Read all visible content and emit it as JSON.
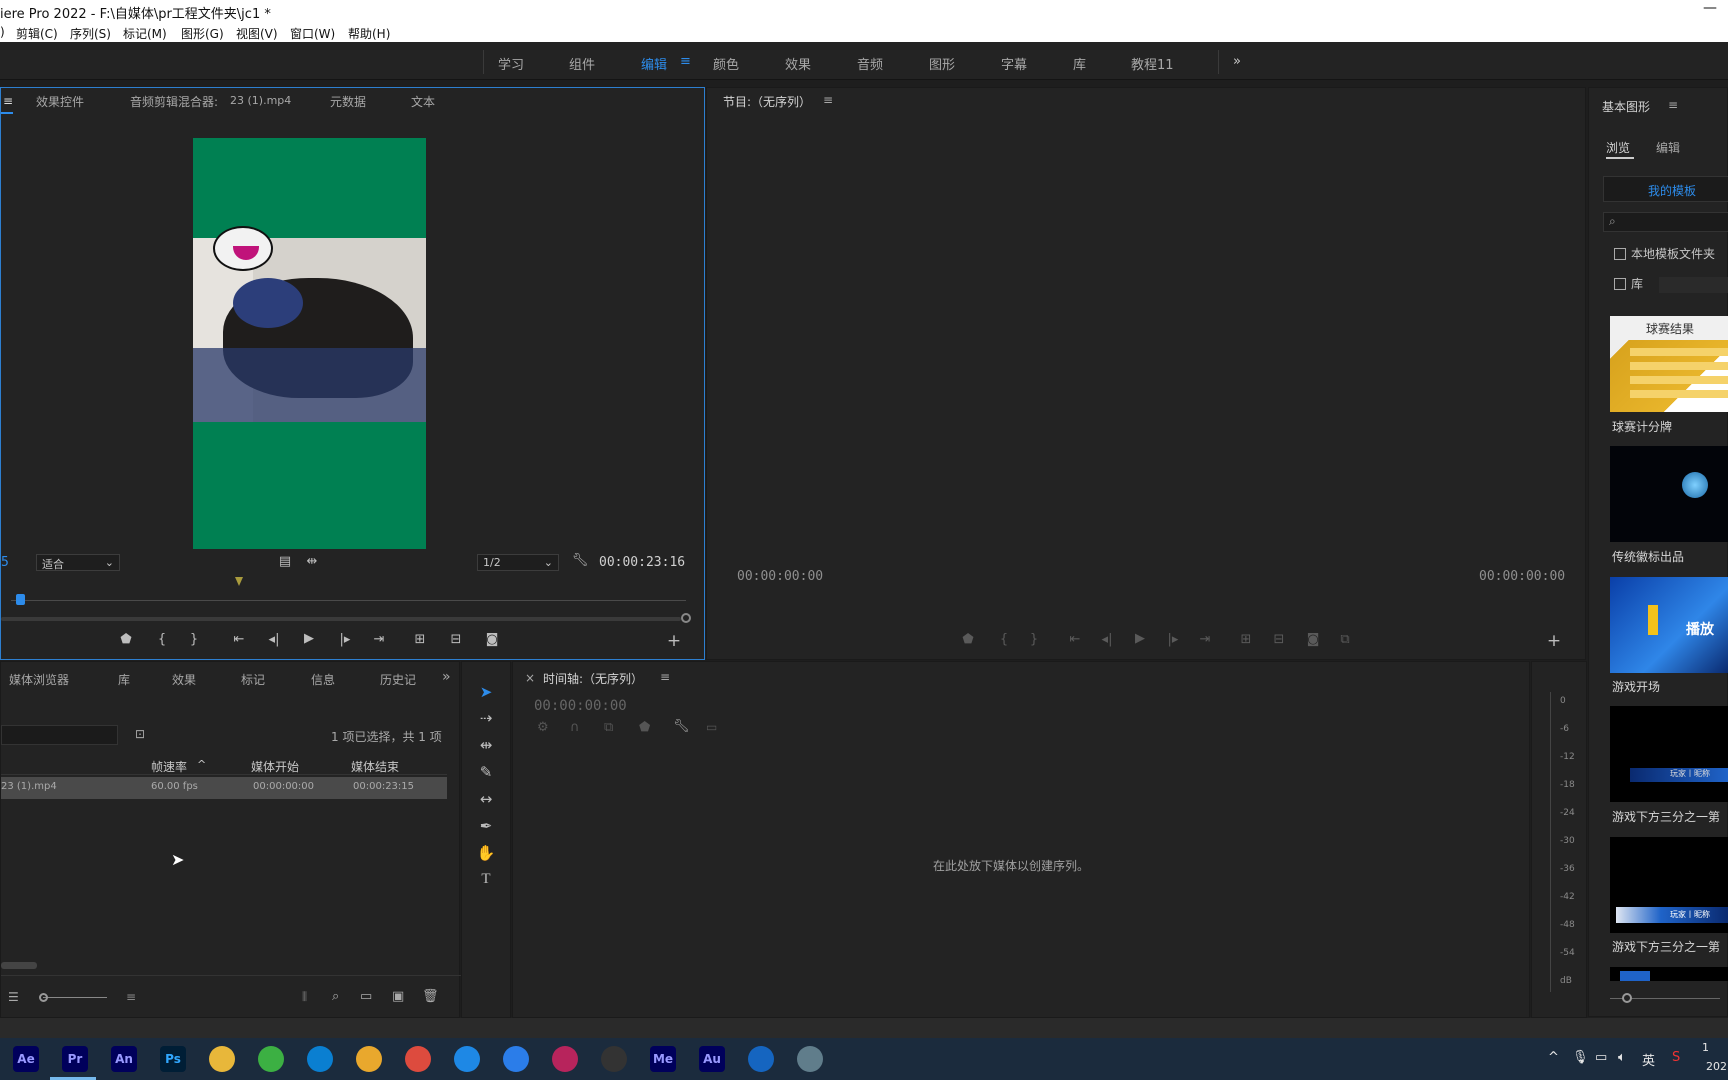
{
  "window": {
    "title": "iere Pro 2022 - F:\\自媒体\\pr工程文件夹\\jc1 *",
    "minimize_glyph": "—"
  },
  "menu": {
    "partial": ")",
    "items": [
      "剪辑(C)",
      "序列(S)",
      "标记(M)",
      "图形(G)",
      "视图(V)",
      "窗口(W)",
      "帮助(H)"
    ]
  },
  "workspaces": {
    "items": [
      "学习",
      "组件",
      "编辑",
      "颜色",
      "效果",
      "音频",
      "图形",
      "字幕",
      "库",
      "教程11"
    ],
    "active": "编辑",
    "menu_glyph": "≡",
    "overflow": "»"
  },
  "source_panel": {
    "tabs": [
      "效果控件",
      "音频剪辑混合器:",
      "元数据",
      "文本"
    ],
    "mixer_clip": "23 (1).mp4",
    "menu_glyph": "≡",
    "playhead_partial": "5",
    "fit_select": "适合",
    "resolution_select": "1/2",
    "timecode": "00:00:23:16",
    "video_bg": "#008052"
  },
  "program_panel": {
    "title": "节目:（无序列）",
    "menu_glyph": "≡",
    "tc_left": "00:00:00:00",
    "tc_right": "00:00:00:00"
  },
  "project_panel": {
    "tabs": [
      "媒体浏览器",
      "库",
      "效果",
      "标记",
      "信息",
      "历史记"
    ],
    "overflow": "»",
    "selection_info": "1 项已选择，共 1 项",
    "columns": [
      "帧速率",
      "媒体开始",
      "媒体结束"
    ],
    "sort_glyph": "^",
    "rows": [
      {
        "name": "23 (1).mp4",
        "fps": "60.00 fps",
        "start": "00:00:00:00",
        "end": "00:00:23:15"
      }
    ]
  },
  "timeline_panel": {
    "close": "×",
    "title": "时间轴:（无序列）",
    "menu_glyph": "≡",
    "timecode": "00:00:00:00",
    "empty_hint": "在此处放下媒体以创建序列。"
  },
  "meter": {
    "labels": [
      "0",
      "-6",
      "-12",
      "-18",
      "-24",
      "-30",
      "-36",
      "-42",
      "-48",
      "-54",
      "dB"
    ]
  },
  "essential_graphics": {
    "title": "基本图形",
    "menu_glyph": "≡",
    "tabs": [
      "浏览",
      "编辑"
    ],
    "active_tab": "浏览",
    "template_select": "我的模板",
    "checkbox_local": "本地模板文件夹",
    "checkbox_lib": "库",
    "templates": [
      {
        "label": "球赛计分牌",
        "thumb_text": "球赛结果"
      },
      {
        "label": "传统徽标出品",
        "thumb_text": ""
      },
      {
        "label": "游戏开场",
        "thumb_text": "播放"
      },
      {
        "label": "游戏下方三分之一第",
        "thumb_text": "玩家丨昵称"
      },
      {
        "label": "游戏下方三分之一第",
        "thumb_text": "玩家丨昵称"
      }
    ]
  },
  "taskbar": {
    "apps": [
      {
        "name": "Ae",
        "color": "#00005b",
        "fg": "#9999ff"
      },
      {
        "name": "Pr",
        "color": "#00005b",
        "fg": "#9999ff"
      },
      {
        "name": "An",
        "color": "#00005b",
        "fg": "#9999ff"
      },
      {
        "name": "Ps",
        "color": "#001e36",
        "fg": "#31a8ff"
      },
      {
        "name": "",
        "color": "#e8b73a",
        "fg": "#fff"
      },
      {
        "name": "",
        "color": "#3cb043",
        "fg": "#fff"
      },
      {
        "name": "",
        "color": "#0a7fd1",
        "fg": "#fff"
      },
      {
        "name": "",
        "color": "#e9a82d",
        "fg": "#fff"
      },
      {
        "name": "",
        "color": "#dd4b3e",
        "fg": "#fff"
      },
      {
        "name": "",
        "color": "#1e88e5",
        "fg": "#fff"
      },
      {
        "name": "",
        "color": "#2b7de9",
        "fg": "#fff"
      },
      {
        "name": "",
        "color": "#b7245c",
        "fg": "#fff"
      },
      {
        "name": "",
        "color": "#333333",
        "fg": "#fff"
      },
      {
        "name": "Me",
        "color": "#00005b",
        "fg": "#9999ff"
      },
      {
        "name": "Au",
        "color": "#00005b",
        "fg": "#9999ff"
      },
      {
        "name": "",
        "color": "#1565c0",
        "fg": "#fff"
      },
      {
        "name": "",
        "color": "#607d8b",
        "fg": "#fff"
      }
    ],
    "tray_up": "^",
    "ime": "英",
    "clock_partial": "1",
    "date_partial": "202"
  }
}
